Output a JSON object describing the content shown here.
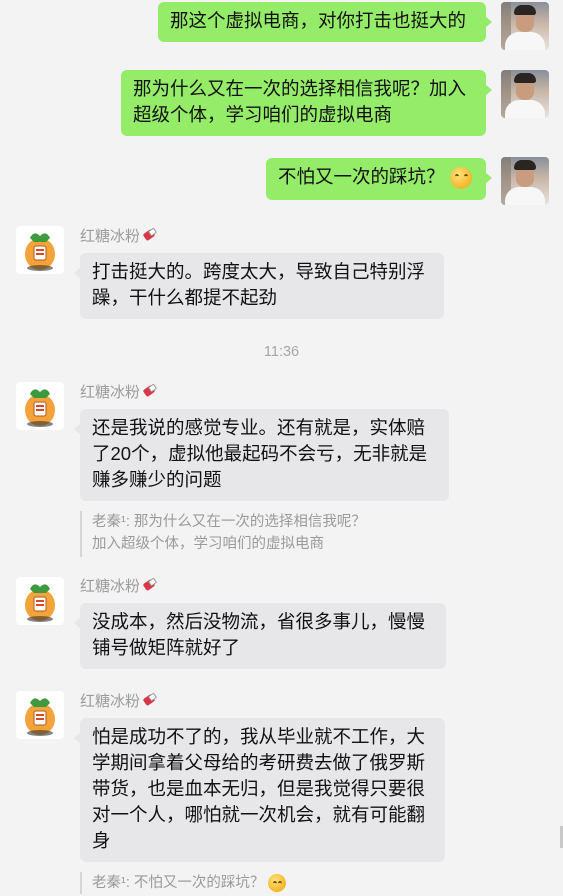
{
  "messages_self": [
    {
      "text": "那这个虚拟电商，对你打击也挺大的"
    },
    {
      "text": "那为什么又在一次的选择相信我呢？加入超级个体，学习咱们的虚拟电商"
    },
    {
      "text": "不怕又一次的踩坑？",
      "emoji": "thinking-face-emoji"
    }
  ],
  "timestamp": "11:36",
  "contact": {
    "name": "红糖冰粉",
    "badge_icon": "red-envelope-icon"
  },
  "messages_other": [
    {
      "text": "打击挺大的。跨度太大，导致自己特别浮躁，干什么都提不起劲"
    },
    {
      "text": "还是我说的感觉专业。还有就是，实体赔了20个，虚拟他最起码不会亏，无非就是赚多赚少的问题",
      "quote": "老秦¹: 那为什么又在一次的选择相信我呢？加入超级个体，学习咱们的虚拟电商"
    },
    {
      "text": "没成本，然后没物流，省很多事儿，慢慢铺号做矩阵就好了"
    },
    {
      "text": "怕是成功不了的，我从毕业就不工作，大学期间拿着父母给的考研费去做了俄罗斯带货，也是血本无归，但是我觉得只要很对一个人，哪怕就一次机会，就有可能翻身",
      "quote": "老秦¹: 不怕又一次的踩坑？"
    }
  ],
  "colors": {
    "self_bubble": "#95ec69",
    "other_bubble": "#e7e7e9",
    "background": "#f3f3f3"
  }
}
